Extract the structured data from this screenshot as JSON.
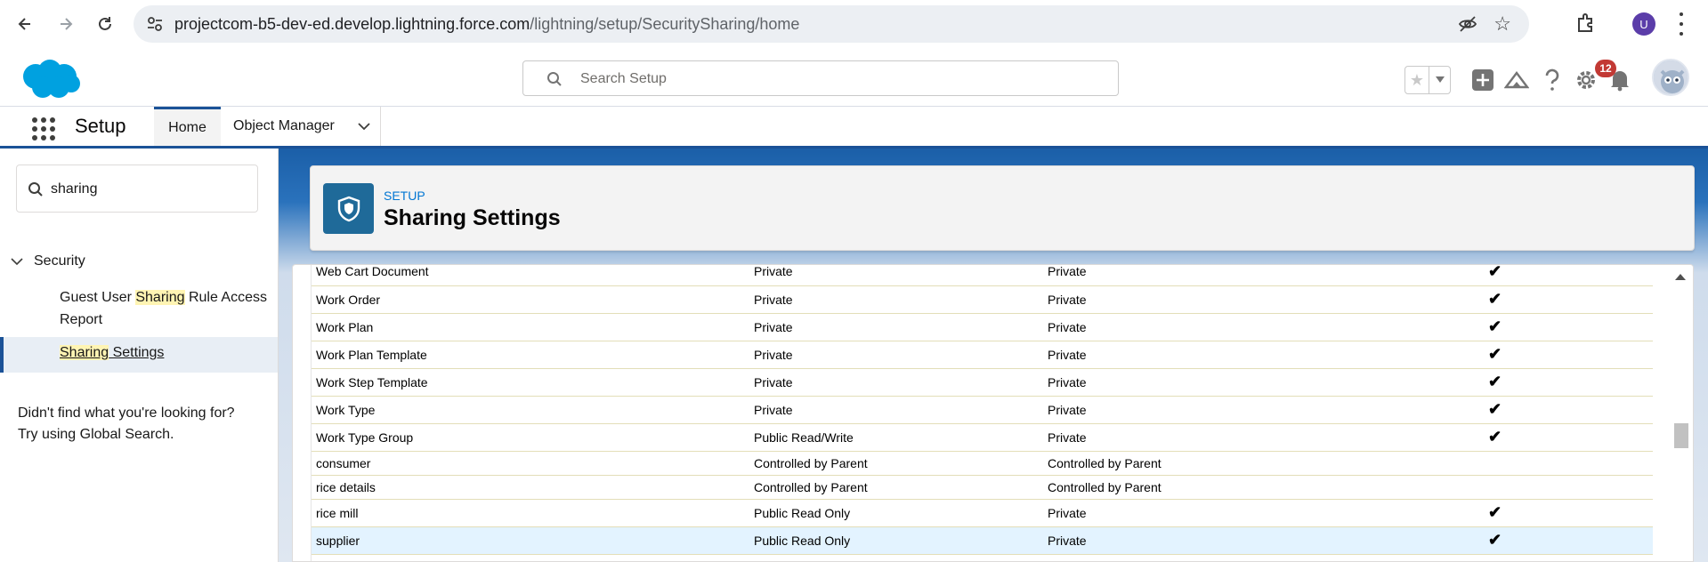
{
  "browser": {
    "url_host": "projectcom-b5-dev-ed.develop.lightning.force.com",
    "url_path": "/lightning/setup/SecuritySharing/home",
    "profile_initial": "U"
  },
  "header": {
    "search_placeholder": "Search Setup",
    "notification_count": "12"
  },
  "nav": {
    "app_name": "Setup",
    "tabs": [
      {
        "label": "Home"
      },
      {
        "label": "Object Manager"
      }
    ]
  },
  "sidebar": {
    "quick_find_value": "sharing",
    "section_label": "Security",
    "items": [
      {
        "pre": "Guest User ",
        "highlight": "Sharing",
        "post": " Rule Access",
        "line2": "Report"
      },
      {
        "pre": "",
        "highlight": "Sharing",
        "post": " Settings"
      }
    ],
    "not_found_line1": "Didn't find what you're looking for?",
    "not_found_line2": "Try using Global Search."
  },
  "page": {
    "eyebrow": "SETUP",
    "title": "Sharing Settings"
  },
  "table": {
    "check_glyph": "✔",
    "rows": [
      {
        "object": "Web Cart Document",
        "internal": "Private",
        "external": "Private",
        "grant": true
      },
      {
        "object": "Work Order",
        "internal": "Private",
        "external": "Private",
        "grant": true
      },
      {
        "object": "Work Plan",
        "internal": "Private",
        "external": "Private",
        "grant": true
      },
      {
        "object": "Work Plan Template",
        "internal": "Private",
        "external": "Private",
        "grant": true
      },
      {
        "object": "Work Step Template",
        "internal": "Private",
        "external": "Private",
        "grant": true
      },
      {
        "object": "Work Type",
        "internal": "Private",
        "external": "Private",
        "grant": true
      },
      {
        "object": "Work Type Group",
        "internal": "Public Read/Write",
        "external": "Private",
        "grant": true
      },
      {
        "object": "consumer",
        "internal": "Controlled by Parent",
        "external": "Controlled by Parent",
        "grant": false
      },
      {
        "object": "rice details",
        "internal": "Controlled by Parent",
        "external": "Controlled by Parent",
        "grant": false
      },
      {
        "object": "rice mill",
        "internal": "Public Read Only",
        "external": "Private",
        "grant": true
      },
      {
        "object": "supplier",
        "internal": "Public Read Only",
        "external": "Private",
        "grant": true,
        "selected": true
      }
    ]
  },
  "colors": {
    "brand_blue": "#1b5297",
    "setup_icon": "#1f6a99",
    "badge_red": "#c23934",
    "highlight_yellow": "#fff4b3",
    "selected_row": "#e3f3ff"
  }
}
